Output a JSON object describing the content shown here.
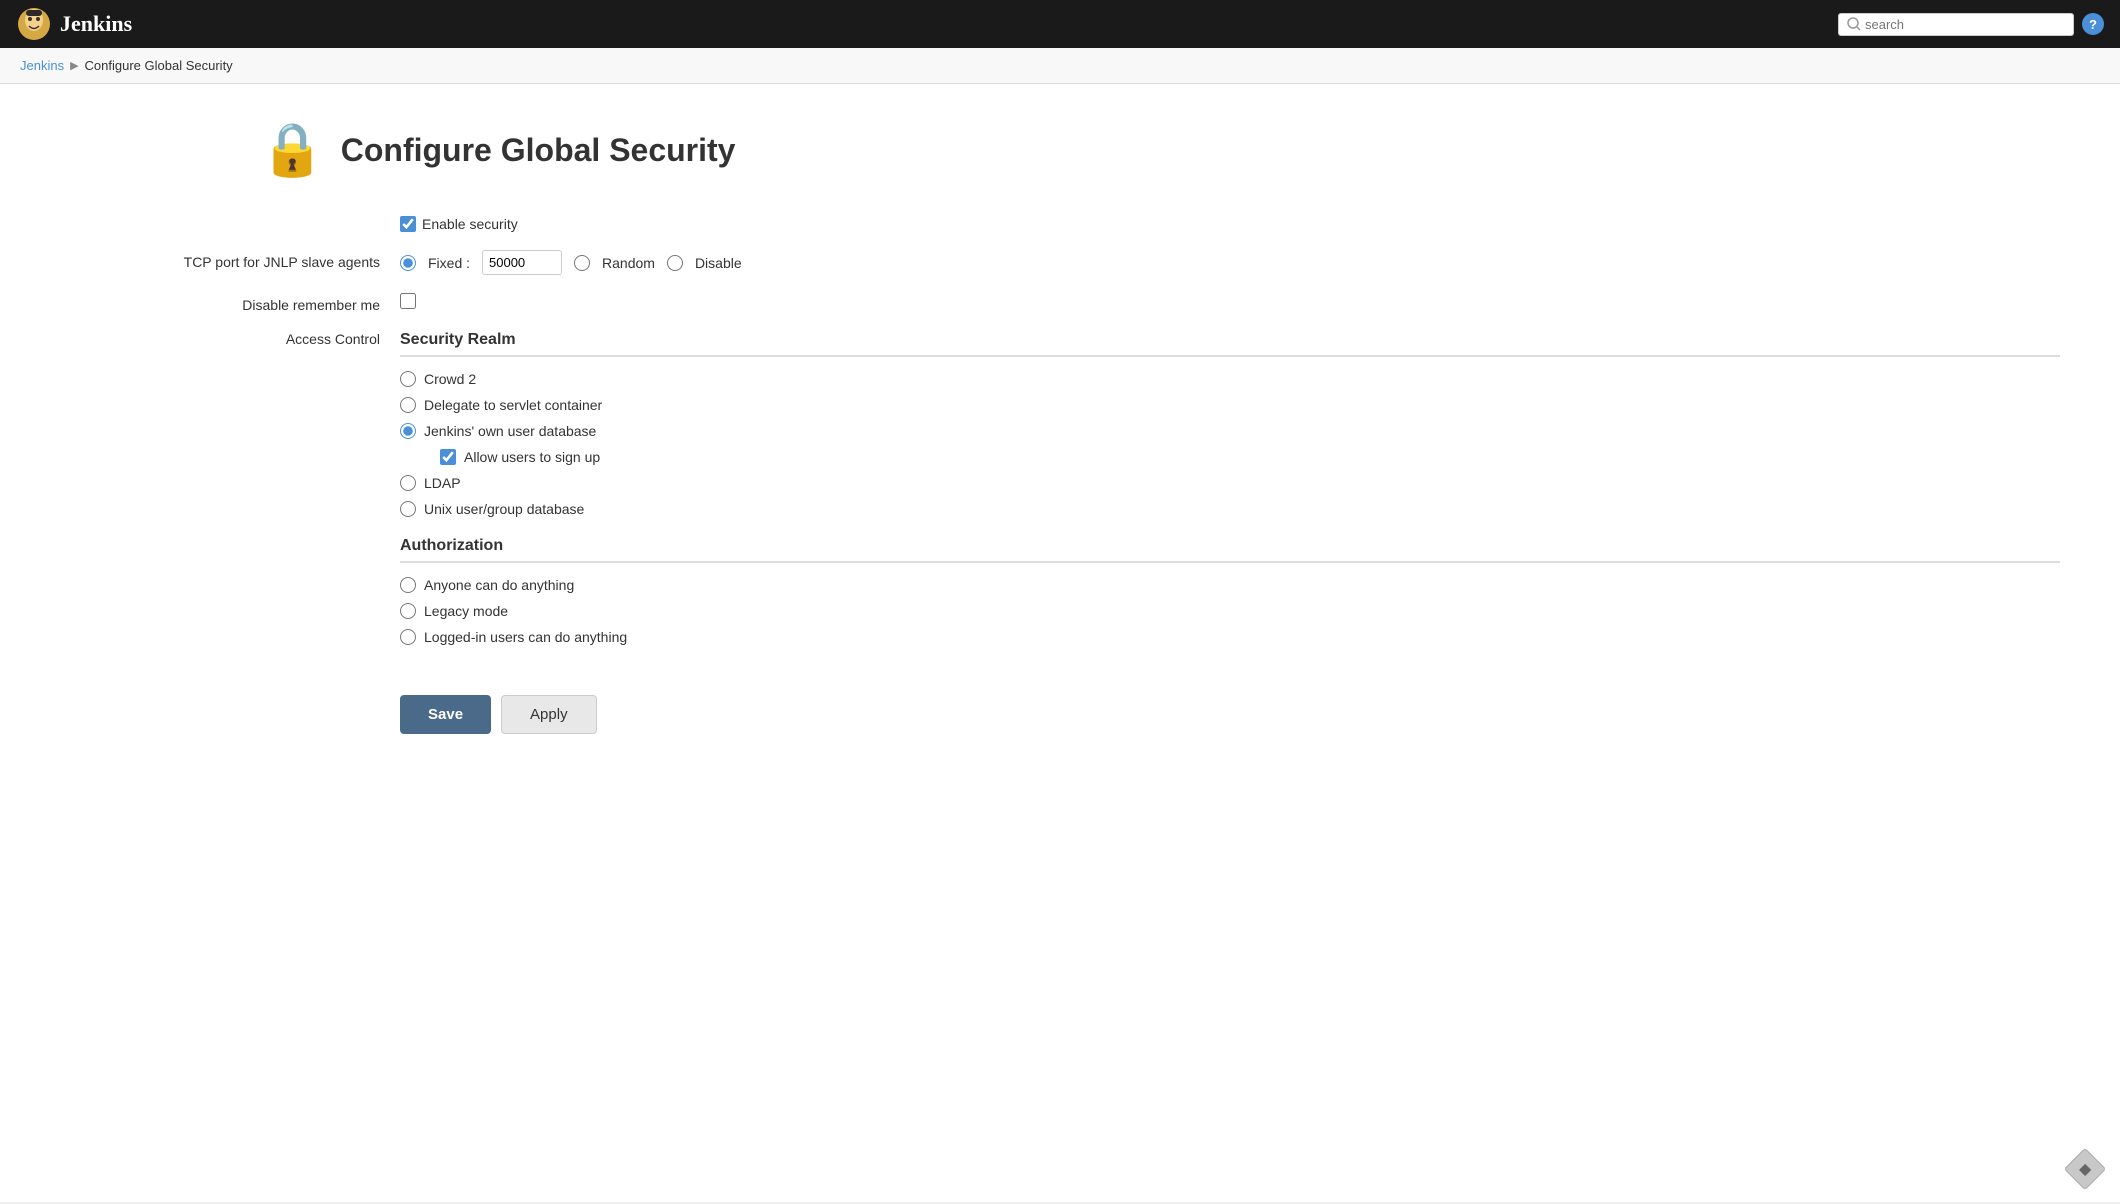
{
  "navbar": {
    "brand": "Jenkins",
    "search_placeholder": "search",
    "help_icon": "?"
  },
  "breadcrumb": {
    "home": "Jenkins",
    "separator": "▶",
    "current": "Configure Global Security"
  },
  "page": {
    "title": "Configure Global Security",
    "lock_icon": "🔒"
  },
  "form": {
    "enable_security_label": "Enable security",
    "enable_security_checked": true,
    "jnlp_label": "TCP port for JNLP slave agents",
    "jnlp_fixed_label": "Fixed :",
    "jnlp_fixed_value": "50000",
    "jnlp_random_label": "Random",
    "jnlp_disable_label": "Disable",
    "disable_remember_me_label": "Disable remember me",
    "access_control_label": "Access Control",
    "security_realm_header": "Security Realm",
    "security_realm_options": [
      {
        "id": "sr_crowd2",
        "label": "Crowd 2",
        "checked": false
      },
      {
        "id": "sr_delegate",
        "label": "Delegate to servlet container",
        "checked": false
      },
      {
        "id": "sr_jenkins_own",
        "label": "Jenkins' own user database",
        "checked": true
      },
      {
        "id": "sr_ldap",
        "label": "LDAP",
        "checked": false
      },
      {
        "id": "sr_unix",
        "label": "Unix user/group database",
        "checked": false
      }
    ],
    "allow_signup_label": "Allow users to sign up",
    "allow_signup_checked": true,
    "authorization_header": "Authorization",
    "authorization_options": [
      {
        "id": "az_anyone",
        "label": "Anyone can do anything",
        "checked": false
      },
      {
        "id": "az_legacy",
        "label": "Legacy mode",
        "checked": false
      },
      {
        "id": "az_loggedin",
        "label": "Logged-in users can do anything",
        "checked": false
      }
    ]
  },
  "buttons": {
    "save_label": "Save",
    "apply_label": "Apply"
  }
}
